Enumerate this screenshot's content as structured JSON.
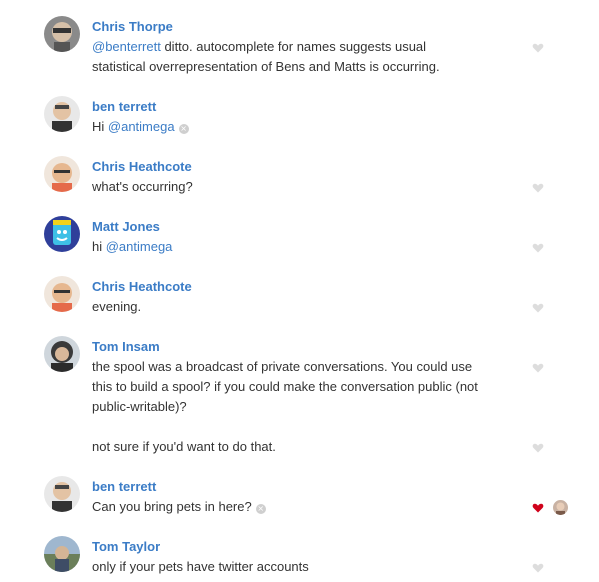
{
  "messages": [
    {
      "author": "Chris Thorpe",
      "avatar": "avatar-chris-thorpe",
      "lines": [
        {
          "mention": "@benterrett",
          "text": " ditto. autocomplete for names suggests usual"
        },
        {
          "text": "statistical overrepresentation of Bens and Matts is occurring."
        }
      ],
      "liked": false
    },
    {
      "author": "ben terrett",
      "avatar": "avatar-ben-terrett",
      "lines": [
        {
          "prefix": "Hi ",
          "mention": "@antimega"
        }
      ],
      "remove_icon": "close-circle-icon",
      "liked": false
    },
    {
      "author": "Chris Heathcote",
      "avatar": "avatar-chris-heathcote",
      "lines": [
        {
          "text": "what's occurring?"
        }
      ],
      "liked": false
    },
    {
      "author": "Matt Jones",
      "avatar": "avatar-matt-jones",
      "lines": [
        {
          "prefix": "hi ",
          "mention": "@antimega"
        }
      ],
      "liked": false
    },
    {
      "author": "Chris Heathcote",
      "avatar": "avatar-chris-heathcote",
      "lines": [
        {
          "text": "evening."
        }
      ],
      "liked": false
    },
    {
      "author": "Tom Insam",
      "avatar": "avatar-tom-insam",
      "lines": [
        {
          "text": "the spool was a broadcast of private conversations. You could use"
        },
        {
          "text": "this to build a spool? if you could make the conversation public (not"
        },
        {
          "text": "public-writable)?"
        }
      ],
      "followup": "not sure if you'd want to do that.",
      "liked": false
    },
    {
      "author": "ben terrett",
      "avatar": "avatar-ben-terrett",
      "lines": [
        {
          "text": "Can you bring pets in here?"
        }
      ],
      "remove_icon": "close-circle-icon",
      "liked": true
    },
    {
      "author": "Tom Taylor",
      "avatar": "avatar-tom-taylor",
      "lines": [
        {
          "text": "only if your pets have twitter accounts"
        }
      ],
      "liked": false
    }
  ],
  "icons": {
    "like": "heart-icon",
    "remove": "close-circle-icon",
    "close_glyph": "×"
  },
  "colors": {
    "author": "#3b7cc6",
    "mention": "#3b7cc6",
    "text": "#333333",
    "heart_inactive": "#dddddd",
    "heart_active": "#d0021b"
  }
}
